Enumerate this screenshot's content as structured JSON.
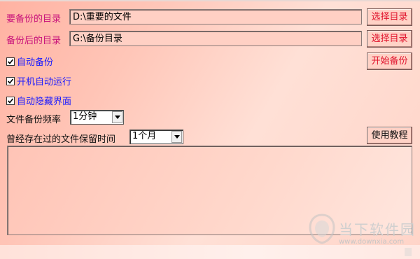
{
  "source": {
    "label": "要备份的目录",
    "path": "D:\\重要的文件",
    "choose_button": "选择目录"
  },
  "destination": {
    "label": "备份后的目录",
    "path": "G:\\备份目录",
    "choose_button": "选择目录"
  },
  "start_button": "开始备份",
  "help_button": "使用教程",
  "options": [
    {
      "label": "自动备份",
      "checked": true
    },
    {
      "label": "开机自动运行",
      "checked": true
    },
    {
      "label": "自动隐藏界面",
      "checked": true
    }
  ],
  "frequency": {
    "label": "文件备份频率",
    "selected": "1分钟"
  },
  "retention": {
    "label": "曾经存在过的文件保留时间",
    "selected": "1个月"
  },
  "watermark": {
    "name": "当下软件园",
    "url": "www.downxia.com"
  },
  "colors": {
    "magenta_label": "#c8107a",
    "blue_label": "#1a1aff",
    "red_button_text": "#e0102a"
  }
}
